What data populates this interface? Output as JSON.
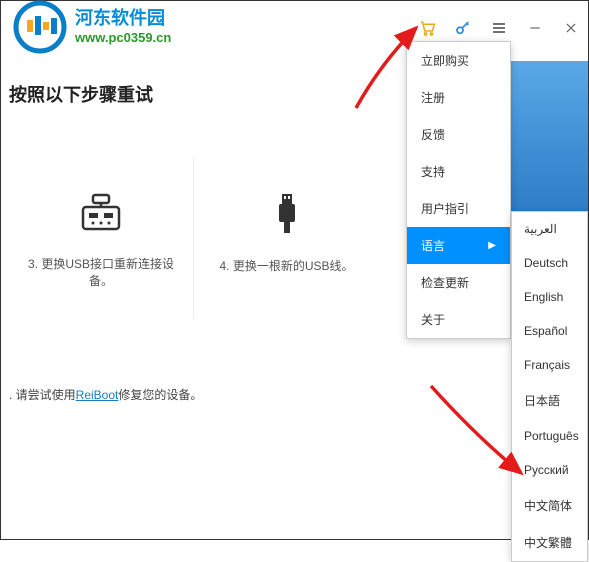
{
  "logo": {
    "cn_text": "河东软件园",
    "url_text": "www.pc0359.cn"
  },
  "heading": "按照以下步骤重试",
  "steps": [
    {
      "label": "3. 更换USB接口重新连接设备。"
    },
    {
      "label": "4. 更换一根新的USB线。"
    }
  ],
  "footer": {
    "prefix": ". 请尝试使用",
    "link": "ReiBoot",
    "suffix": "修复您的设备。"
  },
  "menu": {
    "items": [
      {
        "label": "立即购买"
      },
      {
        "label": "注册"
      },
      {
        "label": "反馈"
      },
      {
        "label": "支持"
      },
      {
        "label": "用户指引"
      },
      {
        "label": "语言",
        "active": true,
        "hasSubmenu": true
      },
      {
        "label": "检查更新"
      },
      {
        "label": "关于"
      }
    ]
  },
  "languages": [
    "العربية",
    "Deutsch",
    "English",
    "Español",
    "Français",
    "日本語",
    "Português",
    "Русский",
    "中文简体",
    "中文繁體"
  ]
}
